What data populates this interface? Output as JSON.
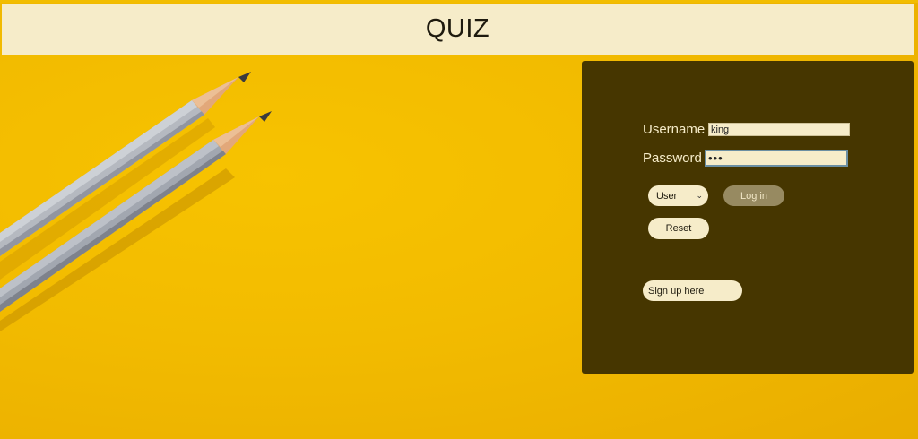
{
  "header": {
    "title": "QUIZ"
  },
  "login": {
    "username_label": "Username :",
    "username_value": "king",
    "password_label": "Password :",
    "password_value": "•••",
    "role_selected": "User",
    "login_label": "Log in",
    "reset_label": "Reset",
    "signup_label": "Sign up here"
  },
  "colors": {
    "background": "#f2bb00",
    "header_bg": "#f6ecc9",
    "panel_bg": "#463600",
    "field_bg": "#f6ecc9",
    "login_button_bg": "#978a61"
  },
  "icons": [
    "pencils-image",
    "chevron-down-icon"
  ]
}
